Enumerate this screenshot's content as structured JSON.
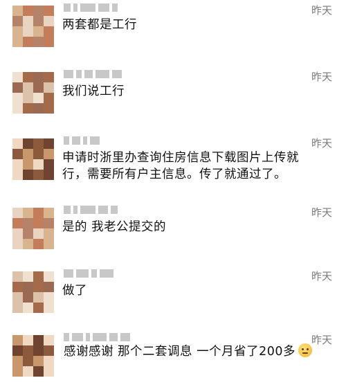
{
  "comments": [
    {
      "time": "昨天",
      "text": "两套都是工行",
      "emoji": false
    },
    {
      "time": "昨天",
      "text": "我们说工行",
      "emoji": false
    },
    {
      "time": "昨天",
      "text": "申请时浙里办查询住房信息下载图片上传就行，需要所有户主信息。传了就通过了。",
      "emoji": false
    },
    {
      "time": "昨天",
      "text": "是的 我老公提交的",
      "emoji": false
    },
    {
      "time": "昨天",
      "text": "做了",
      "emoji": false
    },
    {
      "time": "昨天",
      "text": "感谢感谢 那个二套调息 一个月省了200多",
      "emoji": true,
      "emoji_name": "thinking-face-emoji"
    }
  ]
}
